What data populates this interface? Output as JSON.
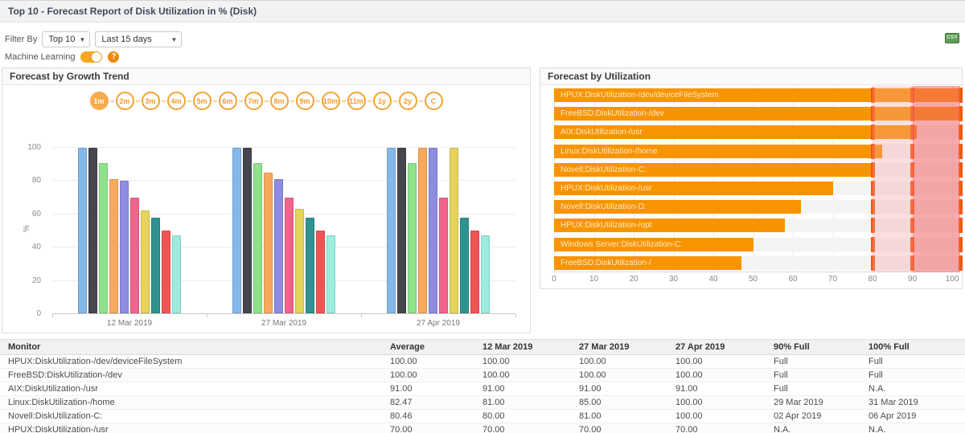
{
  "header": {
    "title": "Top 10 - Forecast Report of Disk Utilization in % (Disk)"
  },
  "filter": {
    "label": "Filter By",
    "top_value": "Top 10",
    "range_value": "Last 15 days",
    "ml_label": "Machine Learning",
    "ml_state": "on",
    "help_glyph": "?",
    "csv_label": "CSV"
  },
  "growth_panel": {
    "title": "Forecast by Growth Trend",
    "range_pills": [
      "1m",
      "2m",
      "3m",
      "4m",
      "5m",
      "6m",
      "7m",
      "8m",
      "9m",
      "10m",
      "11m",
      "1y",
      "2y",
      "C"
    ],
    "selected_pill": "1m"
  },
  "utilization_panel": {
    "title": "Forecast by Utilization"
  },
  "chart_data": [
    {
      "type": "bar",
      "title": "Forecast by Growth Trend",
      "categories": [
        "12 Mar 2019",
        "27 Mar 2019",
        "27 Apr 2019"
      ],
      "series": [
        {
          "name": "HPUX:DiskUtilization-/dev/deviceFileSystem",
          "color": "#85b7e8",
          "values": [
            100,
            100,
            100
          ]
        },
        {
          "name": "FreeBSD:DiskUtilization-/dev",
          "color": "#45464e",
          "values": [
            100,
            100,
            100
          ]
        },
        {
          "name": "AIX:DiskUtilization-/usr",
          "color": "#8ee28a",
          "values": [
            91,
            91,
            91
          ]
        },
        {
          "name": "Linux:DiskUtilization-/home",
          "color": "#f8a95c",
          "values": [
            81,
            85,
            100
          ]
        },
        {
          "name": "Novell:DiskUtilization-C:",
          "color": "#8c8ce0",
          "values": [
            80,
            81,
            100
          ]
        },
        {
          "name": "HPUX:DiskUtilization-/usr",
          "color": "#f2638c",
          "values": [
            70,
            70,
            70
          ]
        },
        {
          "name": "Novell:DiskUtilization-D:",
          "color": "#e5d45c",
          "values": [
            62,
            63,
            100
          ]
        },
        {
          "name": "HPUX:DiskUtilization-/opt",
          "color": "#2f9290",
          "values": [
            58,
            58,
            58
          ]
        },
        {
          "name": "Windows Server:DiskUtilization-C:",
          "color": "#ef5455",
          "values": [
            50,
            50,
            50
          ]
        },
        {
          "name": "FreeBSD:DiskUtilization-/",
          "color": "#9cecdf",
          "values": [
            47,
            47,
            47
          ]
        }
      ],
      "xlabel": "",
      "ylabel": "%",
      "ylim": [
        0,
        100
      ],
      "yticks": [
        0,
        20,
        40,
        60,
        80,
        100
      ],
      "grid": true,
      "legend": "none"
    },
    {
      "type": "bar-horizontal",
      "title": "Forecast by Utilization",
      "categories": [
        "HPUX:DiskUtilization-/dev/deviceFileSystem",
        "FreeBSD:DiskUtilization-/dev",
        "AIX:DiskUtilization-/usr",
        "Linux:DiskUtilization-/home",
        "Novell:DiskUtilization-C:",
        "HPUX:DiskUtilization-/usr",
        "Novell:DiskUtilization-D:",
        "HPUX:DiskUtilization-/opt",
        "Windows Server:DiskUtilization-C:",
        "FreeBSD:DiskUtilization-/"
      ],
      "values": [
        100,
        100,
        91,
        82.47,
        80.46,
        70,
        62,
        58,
        50,
        47
      ],
      "bar_color": "#f79400",
      "xlim": [
        0,
        102
      ],
      "xticks": [
        0,
        10,
        20,
        30,
        40,
        50,
        60,
        70,
        80,
        90,
        100
      ],
      "plot_bands": [
        {
          "from": 80,
          "to": 90,
          "color": "rgba(246,160,160,0.35)"
        },
        {
          "from": 90,
          "to": 102,
          "color": "rgba(242,100,100,0.55)"
        }
      ],
      "plot_lines": [
        {
          "value": 80,
          "color": "#f3570b"
        },
        {
          "value": 90,
          "color": "#f3570b"
        },
        {
          "value": 102,
          "color": "#f3570b"
        }
      ],
      "grid": true,
      "legend": "none"
    }
  ],
  "table": {
    "columns": [
      "Monitor",
      "Average",
      "12 Mar 2019",
      "27 Mar 2019",
      "27 Apr 2019",
      "90% Full",
      "100% Full"
    ],
    "rows": [
      [
        "HPUX:DiskUtilization-/dev/deviceFileSystem",
        "100.00",
        "100.00",
        "100.00",
        "100.00",
        "Full",
        "Full"
      ],
      [
        "FreeBSD:DiskUtilization-/dev",
        "100.00",
        "100.00",
        "100.00",
        "100.00",
        "Full",
        "Full"
      ],
      [
        "AIX:DiskUtilization-/usr",
        "91.00",
        "91.00",
        "91.00",
        "91.00",
        "Full",
        "N.A."
      ],
      [
        "Linux:DiskUtilization-/home",
        "82.47",
        "81.00",
        "85.00",
        "100.00",
        "29 Mar 2019",
        "31 Mar 2019"
      ],
      [
        "Novell:DiskUtilization-C:",
        "80.46",
        "80.00",
        "81.00",
        "100.00",
        "02 Apr 2019",
        "06 Apr 2019"
      ],
      [
        "HPUX:DiskUtilization-/usr",
        "70.00",
        "70.00",
        "70.00",
        "70.00",
        "N.A.",
        "N.A."
      ]
    ]
  }
}
